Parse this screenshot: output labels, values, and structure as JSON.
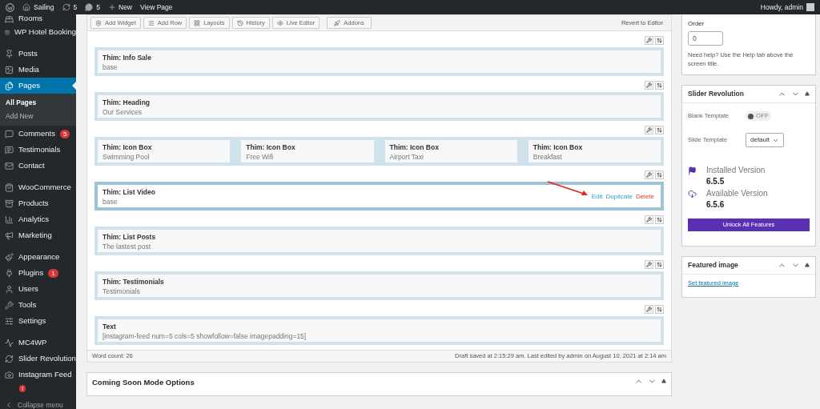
{
  "admin_bar": {
    "site": "Sailing",
    "updates": "5",
    "comments": "5",
    "new": "New",
    "view": "View Page",
    "greeting": "Howdy, admin"
  },
  "sidebar": {
    "groups": [
      [
        {
          "label": "Rooms",
          "selected": false
        },
        {
          "label": "WP Hotel Booking",
          "selected": false
        }
      ],
      [
        {
          "label": "Posts",
          "selected": false
        },
        {
          "label": "Media",
          "selected": false
        },
        {
          "label": "Pages",
          "selected": true,
          "submenu": [
            {
              "label": "All Pages",
              "selected": true
            },
            {
              "label": "Add New",
              "selected": false
            }
          ]
        },
        {
          "label": "Comments",
          "selected": false,
          "badge": "5"
        },
        {
          "label": "Testimonials",
          "selected": false
        },
        {
          "label": "Contact",
          "selected": false
        }
      ],
      [
        {
          "label": "WooCommerce",
          "selected": false
        },
        {
          "label": "Products",
          "selected": false
        },
        {
          "label": "Analytics",
          "selected": false
        },
        {
          "label": "Marketing",
          "selected": false
        }
      ],
      [
        {
          "label": "Appearance",
          "selected": false
        },
        {
          "label": "Plugins",
          "selected": false,
          "badge": "1"
        },
        {
          "label": "Users",
          "selected": false
        },
        {
          "label": "Tools",
          "selected": false
        },
        {
          "label": "Settings",
          "selected": false
        }
      ],
      [
        {
          "label": "MC4WP",
          "selected": false
        },
        {
          "label": "Slider Revolution",
          "selected": false
        },
        {
          "label": "Instagram Feed",
          "selected": false,
          "badge": "!"
        }
      ]
    ],
    "collapse": "Collapse menu"
  },
  "toolbar": {
    "buttons": [
      "Add Widget",
      "Add Row",
      "Layouts",
      "History",
      "Live Editor",
      "Addons"
    ],
    "revert": "Revert to Editor"
  },
  "rows": [
    {
      "widgets": [
        {
          "title": "Thim: Info Sale",
          "subtitle": "base",
          "selected": false
        }
      ]
    },
    {
      "widgets": [
        {
          "title": "Thim: Heading",
          "subtitle": "Our Services",
          "selected": false
        }
      ]
    },
    {
      "widgets": [
        {
          "title": "Thim: Icon Box",
          "subtitle": "Swimming Pool",
          "selected": false
        },
        {
          "title": "Thim: Icon Box",
          "subtitle": "Free Wifi",
          "selected": false
        },
        {
          "title": "Thim: Icon Box",
          "subtitle": "Airport Taxi",
          "selected": false
        },
        {
          "title": "Thim: Icon Box",
          "subtitle": "Breakfast",
          "selected": false
        }
      ]
    },
    {
      "widgets": [
        {
          "title": "Thim: List Video",
          "subtitle": "base",
          "selected": true,
          "actions": [
            {
              "label": "Edit",
              "kind": "edit"
            },
            {
              "label": "Duplicate",
              "kind": "duplicate"
            },
            {
              "label": "Delete",
              "kind": "delete"
            }
          ]
        }
      ]
    },
    {
      "widgets": [
        {
          "title": "Thim: List Posts",
          "subtitle": "The lastest post",
          "selected": false
        }
      ]
    },
    {
      "widgets": [
        {
          "title": "Thim: Testimonials",
          "subtitle": "Testimonials",
          "selected": false
        }
      ]
    },
    {
      "widgets": [
        {
          "title": "Text",
          "subtitle": "[instagram-feed num=5 cols=5 showfollow=false imagepadding=15]",
          "selected": false
        }
      ]
    }
  ],
  "status_bar": {
    "word_count": "Word count: 26",
    "saved": "Draft saved at 2:15:29 am. Last edited by admin on August 10, 2021 at 2:14 am"
  },
  "coming_soon": {
    "title": "Coming Soon Mode Options"
  },
  "order_box": {
    "label": "Order",
    "value": "0",
    "help": "Need help? Use the Help tab above the screen title."
  },
  "slider_box": {
    "title": "Slider Revolution",
    "blank_label": "Blank Template",
    "blank_on": false,
    "toggle_text": "OFF",
    "slide_label": "Slide Template",
    "slide_value": "default",
    "installed_label": "Installed Version",
    "installed": "6.5.5",
    "available_label": "Available Version",
    "available": "6.5.6",
    "unlock": "Unlock All Features"
  },
  "featured_box": {
    "title": "Featured image",
    "link": "Set featured image"
  }
}
